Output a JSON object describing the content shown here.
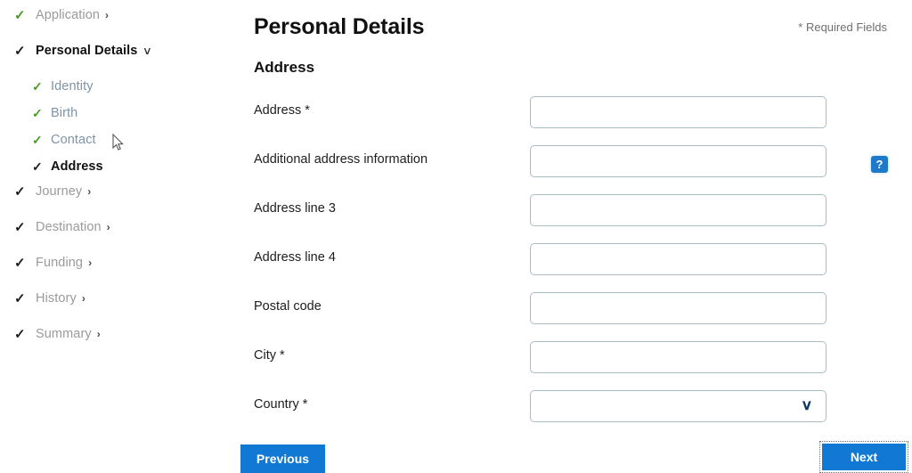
{
  "sidebar": {
    "items": [
      {
        "label": "Application",
        "check": "green",
        "state": "muted",
        "chevron": "right"
      },
      {
        "label": "Personal Details",
        "check": "dark",
        "state": "head",
        "chevron": "down"
      },
      {
        "label": "Identity",
        "check": "green",
        "state": "link",
        "chevron": "none",
        "sub": true
      },
      {
        "label": "Birth",
        "check": "green",
        "state": "link",
        "chevron": "none",
        "sub": true
      },
      {
        "label": "Contact",
        "check": "green",
        "state": "link",
        "chevron": "none",
        "sub": true
      },
      {
        "label": "Address",
        "check": "dark",
        "state": "active",
        "chevron": "none",
        "sub": true
      },
      {
        "label": "Journey",
        "check": "dark",
        "state": "muted",
        "chevron": "right"
      },
      {
        "label": "Destination",
        "check": "dark",
        "state": "muted",
        "chevron": "right"
      },
      {
        "label": "Funding",
        "check": "dark",
        "state": "muted",
        "chevron": "right"
      },
      {
        "label": "History",
        "check": "dark",
        "state": "muted",
        "chevron": "right"
      },
      {
        "label": "Summary",
        "check": "dark",
        "state": "muted",
        "chevron": "right"
      }
    ]
  },
  "main": {
    "page_title": "Personal Details",
    "section_title": "Address",
    "required_note": "* Required Fields",
    "help_icon": "?",
    "select_chevron": "❯"
  },
  "fields": [
    {
      "label": "Address *",
      "value": "",
      "placeholder": "",
      "type": "text",
      "help": false
    },
    {
      "label": "Additional address information",
      "value": "",
      "placeholder": "",
      "type": "text",
      "help": true
    },
    {
      "label": "Address line 3",
      "value": "",
      "placeholder": "",
      "type": "text",
      "help": false
    },
    {
      "label": "Address line 4",
      "value": "",
      "placeholder": "",
      "type": "text",
      "help": false
    },
    {
      "label": "Postal code",
      "value": "",
      "placeholder": "",
      "type": "text",
      "help": false
    },
    {
      "label": "City *",
      "value": "",
      "placeholder": "",
      "type": "text",
      "help": false
    },
    {
      "label": "Country *",
      "value": "",
      "placeholder": "",
      "type": "select",
      "help": false
    }
  ],
  "buttons": {
    "previous": "Previous",
    "next": "Next"
  },
  "colors": {
    "accent_blue": "#1179d4",
    "check_green": "#4a9a2a",
    "link_grey_blue": "#7d94a8",
    "input_border": "#a8bcc4",
    "help_badge": "#1e79c8"
  }
}
